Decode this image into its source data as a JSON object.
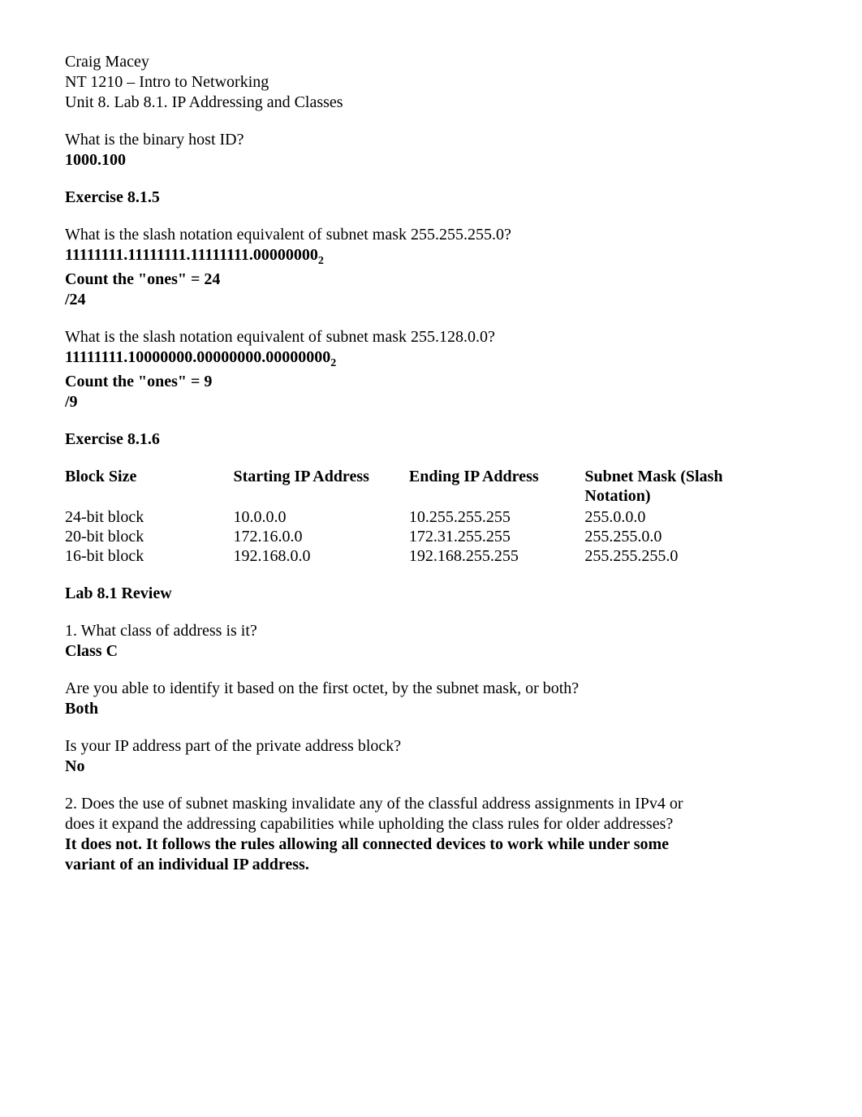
{
  "header": {
    "author": "Craig Macey",
    "course": "NT 1210 – Intro to Networking",
    "unit": "Unit 8. Lab 8.1. IP Addressing and Classes"
  },
  "q_host_id": {
    "question": "What is the binary host ID?",
    "answer": "1000.100"
  },
  "ex815": {
    "heading": "Exercise 8.1.5",
    "q1": {
      "question": "What is the slash notation equivalent of subnet mask 255.255.255.0?",
      "binary": "11111111.11111111.11111111.00000000",
      "sub": "2",
      "count": "Count the \"ones\" = 24",
      "answer": "/24"
    },
    "q2": {
      "question": "What is the slash notation equivalent of subnet mask 255.128.0.0?",
      "binary": "11111111.10000000.00000000.00000000",
      "sub": "2",
      "count": "Count the \"ones\" = 9",
      "answer": "/9"
    }
  },
  "ex816": {
    "heading": "Exercise 8.1.6",
    "headers": {
      "c1": "Block Size",
      "c2": "Starting IP Address",
      "c3": "Ending IP Address",
      "c4a": "Subnet Mask (Slash",
      "c4b": "Notation)"
    },
    "rows": [
      {
        "c1": "24-bit block",
        "c2": "10.0.0.0",
        "c3": "10.255.255.255",
        "c4": "255.0.0.0"
      },
      {
        "c1": "20-bit block",
        "c2": "172.16.0.0",
        "c3": "172.31.255.255",
        "c4": "255.255.0.0"
      },
      {
        "c1": "16-bit block",
        "c2": "192.168.0.0",
        "c3": "192.168.255.255",
        "c4": "255.255.255.0"
      }
    ]
  },
  "review": {
    "heading": "Lab 8.1 Review",
    "q1": {
      "question": "1. What class of address is it?",
      "answer": "Class C"
    },
    "q2": {
      "question": "Are you able to identify it based on the first octet, by the subnet mask, or both?",
      "answer": "Both"
    },
    "q3": {
      "question": "Is your IP address part of the private address block?",
      "answer": "No"
    },
    "q4": {
      "line1": "2. Does the use of subnet masking invalidate any of the classful address assignments in IPv4 or",
      "line2": "does it expand the addressing capabilities while upholding the class rules for older addresses?",
      "answer1": "It does not.  It follows the rules allowing all connected devices to work while under some",
      "answer2": "variant of an individual IP address."
    }
  }
}
